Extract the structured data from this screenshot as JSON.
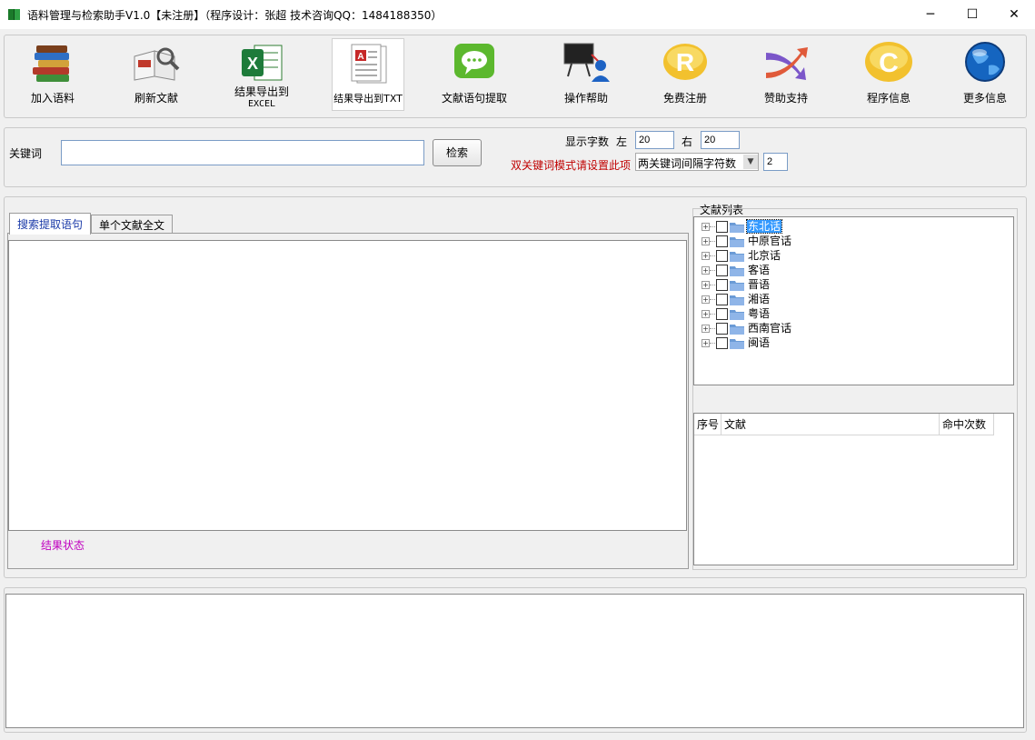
{
  "window": {
    "title": "语料管理与检索助手V1.0【未注册】（程序设计：张超  技术咨询QQ：1484188350）",
    "minimize": "─",
    "maximize": "☐",
    "close": "✕"
  },
  "toolbar": {
    "items": [
      {
        "label": "加入语料",
        "icon": "books-icon"
      },
      {
        "label": "刷新文献",
        "icon": "book-magnifier-icon"
      },
      {
        "label": "结果导出到",
        "label2": "EXCEL",
        "icon": "excel-icon"
      },
      {
        "label": "结果导出到TXT",
        "icon": "text-document-icon"
      },
      {
        "label": "文献语句提取",
        "icon": "chat-bubble-icon"
      },
      {
        "label": "操作帮助",
        "icon": "presenter-board-icon"
      },
      {
        "label": "免费注册",
        "icon": "registered-icon"
      },
      {
        "label": "赞助支持",
        "icon": "arrows-cross-icon"
      },
      {
        "label": "程序信息",
        "icon": "copyright-icon"
      },
      {
        "label": "更多信息",
        "icon": "globe-icon"
      }
    ]
  },
  "search": {
    "keyword_label": "关键词",
    "keyword_value": "",
    "search_button": "检索",
    "display_chars_label": "显示字数",
    "left_label": "左",
    "left_value": "20",
    "right_label": "右",
    "right_value": "20",
    "dual_hint": "双关键词模式请设置此项",
    "gap_select": "两关键词间隔字符数",
    "gap_value": "2"
  },
  "results": {
    "tabs": [
      "搜索提取语句",
      "单个文献全文"
    ],
    "status": "结果状态"
  },
  "doc_list": {
    "title": "文献列表",
    "tree": [
      "东北话",
      "中原官话",
      "北京话",
      "客语",
      "晋语",
      "湘语",
      "粤语",
      "西南官话",
      "闽语"
    ],
    "selected": "东北话",
    "table_headers": [
      "序号",
      "文献",
      "命中次数"
    ]
  },
  "colors": {
    "hint_red": "#c00000",
    "status_magenta": "#c000c0",
    "selection_blue": "#3399ff"
  }
}
